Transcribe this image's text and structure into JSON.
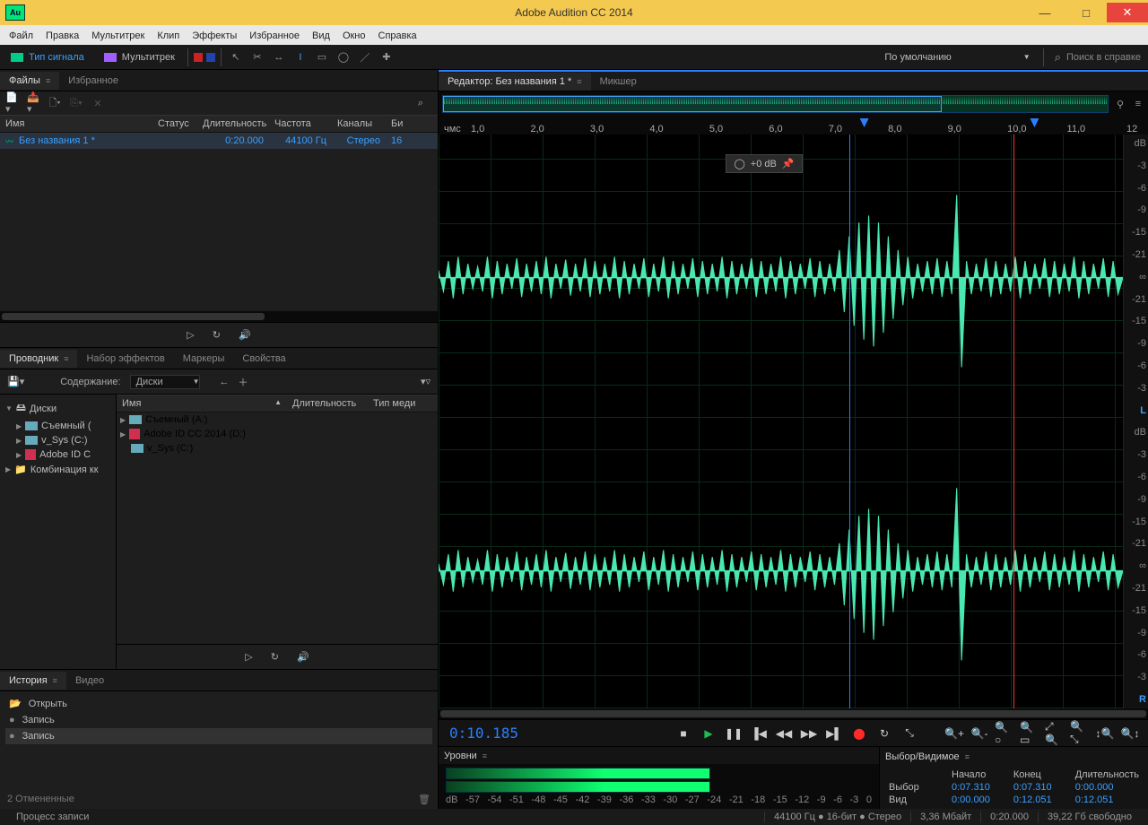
{
  "title": "Adobe Audition CC 2014",
  "logo_text": "Au",
  "menu": [
    "Файл",
    "Правка",
    "Мультитрек",
    "Клип",
    "Эффекты",
    "Избранное",
    "Вид",
    "Окно",
    "Справка"
  ],
  "modes": {
    "waveform": "Тип сигнала",
    "multitrack": "Мультитрек"
  },
  "workspace_dropdown": "По умолчанию",
  "search_placeholder": "Поиск в справке",
  "files": {
    "tabs": [
      "Файлы",
      "Избранное"
    ],
    "columns": {
      "name": "Имя",
      "status": "Статус",
      "duration": "Длительность",
      "freq": "Частота",
      "channels": "Каналы",
      "bits": "Би"
    },
    "rows": [
      {
        "name": "Без названия 1 *",
        "duration": "0:20.000",
        "freq": "44100 Гц",
        "channels": "Стерео",
        "bits": "16"
      }
    ]
  },
  "explorer": {
    "tabs": [
      "Проводник",
      "Набор эффектов",
      "Маркеры",
      "Свойства"
    ],
    "content_label": "Содержание:",
    "content_value": "Диски",
    "tree": [
      "Диски",
      "Съемный (",
      "v_Sys (C:)",
      "Adobe ID C",
      "Комбинация кк"
    ],
    "list_cols": {
      "name": "Имя",
      "duration": "Длительность",
      "media": "Тип меди"
    },
    "list": [
      "Съемный (A:)",
      "Adobe ID CC 2014 (D:)",
      "v_Sys (C:)"
    ]
  },
  "history": {
    "tabs": [
      "История",
      "Видео"
    ],
    "items": [
      "Открыть",
      "Запись",
      "Запись"
    ],
    "footer": "2 Отмененные"
  },
  "editor": {
    "tabs": [
      "Редактор: Без названия 1 *",
      "Микшер"
    ],
    "ruler_label": "чмс",
    "ruler": [
      "1,0",
      "2,0",
      "3,0",
      "4,0",
      "5,0",
      "6,0",
      "7,0",
      "8,0",
      "9,0",
      "10,0",
      "11,0",
      "12"
    ],
    "db_scale": [
      "dB",
      "-3",
      "-6",
      "-9",
      "-15",
      "-21",
      "∞",
      "-21",
      "-15",
      "-9",
      "-6",
      "-3",
      "dB"
    ],
    "ch_L": "L",
    "ch_R": "R",
    "gain": "+0 dB",
    "timecode": "0:10.185"
  },
  "levels": {
    "tab": "Уровни",
    "scale": [
      "dB",
      "-57",
      "-54",
      "-51",
      "-48",
      "-45",
      "-42",
      "-39",
      "-36",
      "-33",
      "-30",
      "-27",
      "-24",
      "-21",
      "-18",
      "-15",
      "-12",
      "-9",
      "-6",
      "-3",
      "0"
    ]
  },
  "selection": {
    "tab": "Выбор/Видимое",
    "headers": {
      "start": "Начало",
      "end": "Конец",
      "dur": "Длительность"
    },
    "rows": [
      {
        "label": "Выбор",
        "start": "0:07.310",
        "end": "0:07.310",
        "dur": "0:00.000"
      },
      {
        "label": "Вид",
        "start": "0:00.000",
        "end": "0:12.051",
        "dur": "0:12.051"
      }
    ]
  },
  "status": {
    "process": "Процесс записи",
    "format": "44100 Гц ● 16-бит ● Стерео",
    "size": "3,36 Мбайт",
    "dur": "0:20.000",
    "disk": "39,22 Гб свободно"
  }
}
